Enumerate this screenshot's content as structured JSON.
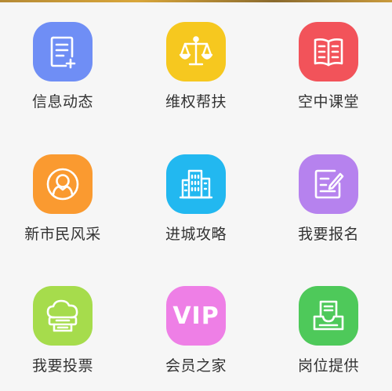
{
  "tiles": [
    {
      "label": "信息动态",
      "icon": "news-document-icon",
      "color": "#6f8ef5"
    },
    {
      "label": "维权帮扶",
      "icon": "balance-scale-icon",
      "color": "#f6c81f"
    },
    {
      "label": "空中课堂",
      "icon": "open-book-icon",
      "color": "#f2535a"
    },
    {
      "label": "新市民风采",
      "icon": "person-profile-icon",
      "color": "#fa9a30"
    },
    {
      "label": "进城攻略",
      "icon": "city-buildings-icon",
      "color": "#22b8f0"
    },
    {
      "label": "我要报名",
      "icon": "edit-form-icon",
      "color": "#b682ee"
    },
    {
      "label": "我要投票",
      "icon": "cloud-ballot-icon",
      "color": "#a6dc4c"
    },
    {
      "label": "会员之家",
      "icon": "vip-text-icon",
      "color": "#ee7fe6",
      "icon_text": "VIP"
    },
    {
      "label": "岗位提供",
      "icon": "job-inbox-icon",
      "color": "#4ec95a"
    }
  ]
}
